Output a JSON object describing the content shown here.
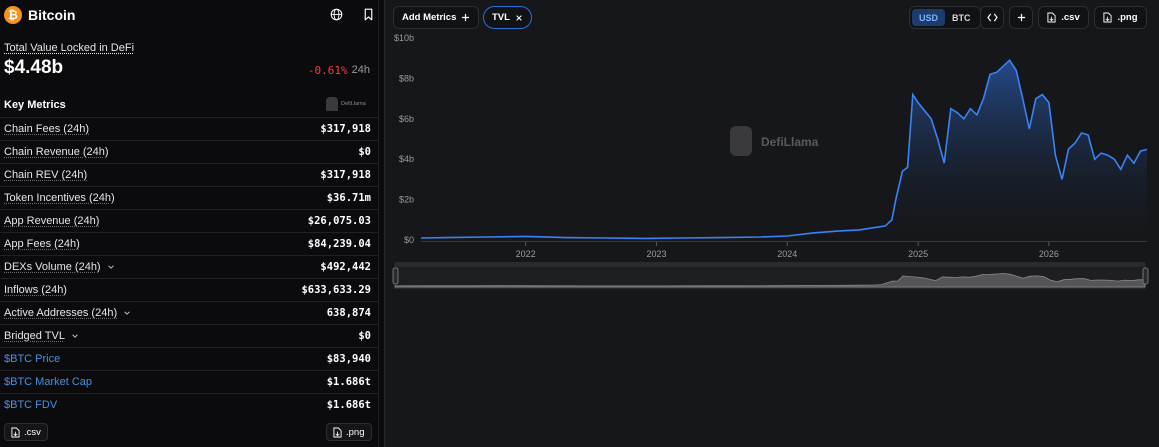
{
  "header": {
    "chain_name": "Bitcoin",
    "logo_glyph": "₿",
    "globe_icon": "globe-icon",
    "bookmark_icon": "bookmark-icon"
  },
  "tvl": {
    "label": "Total Value Locked in DeFi",
    "value": "$4.48b",
    "change": "-0.61%",
    "period": "24h"
  },
  "key_metrics": {
    "title": "Key Metrics",
    "brand": "DefiLlama",
    "rows": [
      {
        "label": "Chain Fees (24h)",
        "value": "$317,918",
        "chevron": false,
        "link": false
      },
      {
        "label": "Chain Revenue (24h)",
        "value": "$0",
        "chevron": false,
        "link": false
      },
      {
        "label": "Chain REV (24h)",
        "value": "$317,918",
        "chevron": false,
        "link": false
      },
      {
        "label": "Token Incentives (24h)",
        "value": "$36.71m",
        "chevron": false,
        "link": false
      },
      {
        "label": "App Revenue (24h)",
        "value": "$26,075.03",
        "chevron": false,
        "link": false
      },
      {
        "label": "App Fees (24h)",
        "value": "$84,239.04",
        "chevron": false,
        "link": false
      },
      {
        "label": "DEXs Volume (24h)",
        "value": "$492,442",
        "chevron": true,
        "link": false
      },
      {
        "label": "Inflows (24h)",
        "value": "$633,633.29",
        "chevron": false,
        "link": false
      },
      {
        "label": "Active Addresses (24h)",
        "value": "638,874",
        "chevron": true,
        "link": false
      },
      {
        "label": "Bridged TVL",
        "value": "$0",
        "chevron": true,
        "link": false
      },
      {
        "label": "$BTC Price",
        "value": "$83,940",
        "chevron": false,
        "link": true
      },
      {
        "label": "$BTC Market Cap",
        "value": "$1.686t",
        "chevron": false,
        "link": true
      },
      {
        "label": "$BTC FDV",
        "value": "$1.686t",
        "chevron": false,
        "link": true
      }
    ]
  },
  "left_buttons": {
    "csv": ".csv",
    "png": ".png"
  },
  "toolbar": {
    "add_metrics": "Add Metrics",
    "tvl_pill": "TVL",
    "usd": "USD",
    "btc": "BTC",
    "embed_icon": "code-icon",
    "plus_icon": "plus-icon",
    "csv": ".csv",
    "png": ".png"
  },
  "colors": {
    "accent": "#2a6fd6",
    "line": "#3b82f6",
    "negative": "#fd3c3c",
    "btc": "#f7931a"
  },
  "chart_data": {
    "type": "area",
    "series": [
      {
        "name": "TVL",
        "x": [
          2021.2,
          2021.4,
          2021.7,
          2022.0,
          2022.3,
          2022.6,
          2022.9,
          2023.2,
          2023.5,
          2023.8,
          2024.0,
          2024.2,
          2024.4,
          2024.55,
          2024.65,
          2024.75,
          2024.8,
          2024.83,
          2024.88,
          2024.92,
          2024.96,
          2025.0,
          2025.05,
          2025.1,
          2025.15,
          2025.2,
          2025.25,
          2025.3,
          2025.35,
          2025.4,
          2025.45,
          2025.5,
          2025.55,
          2025.6,
          2025.65,
          2025.7,
          2025.75,
          2025.8,
          2025.85,
          2025.9,
          2025.95,
          2026.0,
          2026.05,
          2026.1,
          2026.15,
          2026.2,
          2026.25,
          2026.3,
          2026.35,
          2026.4,
          2026.45,
          2026.5,
          2026.55,
          2026.6,
          2026.65,
          2026.7,
          2026.75
        ],
        "values": [
          0.1,
          0.12,
          0.15,
          0.18,
          0.12,
          0.1,
          0.08,
          0.1,
          0.12,
          0.15,
          0.2,
          0.35,
          0.45,
          0.5,
          0.6,
          0.7,
          1.0,
          2.0,
          3.4,
          3.6,
          7.2,
          6.8,
          6.4,
          6.0,
          5.0,
          3.8,
          6.5,
          6.3,
          6.0,
          6.5,
          6.2,
          7.0,
          8.2,
          8.3,
          8.6,
          8.9,
          8.4,
          7.0,
          5.5,
          7.0,
          7.2,
          6.8,
          4.2,
          3.0,
          4.5,
          4.8,
          5.3,
          5.2,
          4.0,
          4.3,
          4.2,
          4.0,
          3.5,
          4.2,
          3.8,
          4.4,
          4.48
        ]
      }
    ],
    "xticks": [
      "2022",
      "2023",
      "2024",
      "2025",
      "2026"
    ],
    "xtick_values": [
      2022,
      2023,
      2024,
      2025,
      2026
    ],
    "yticks": [
      "$0",
      "$2b",
      "$4b",
      "$6b",
      "$8b",
      "$10b"
    ],
    "ytick_values": [
      0,
      2,
      4,
      6,
      8,
      10
    ],
    "xlim": [
      2021.2,
      2026.75
    ],
    "ylim": [
      0,
      10
    ],
    "watermark": "DefiLlama",
    "grid": false
  }
}
